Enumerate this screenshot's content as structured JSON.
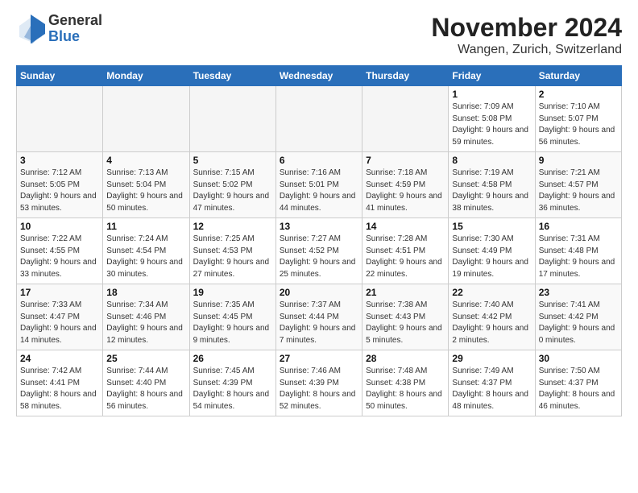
{
  "logo": {
    "general": "General",
    "blue": "Blue"
  },
  "title": "November 2024",
  "location": "Wangen, Zurich, Switzerland",
  "days_of_week": [
    "Sunday",
    "Monday",
    "Tuesday",
    "Wednesday",
    "Thursday",
    "Friday",
    "Saturday"
  ],
  "weeks": [
    [
      {
        "day": "",
        "info": ""
      },
      {
        "day": "",
        "info": ""
      },
      {
        "day": "",
        "info": ""
      },
      {
        "day": "",
        "info": ""
      },
      {
        "day": "",
        "info": ""
      },
      {
        "day": "1",
        "info": "Sunrise: 7:09 AM\nSunset: 5:08 PM\nDaylight: 9 hours and 59 minutes."
      },
      {
        "day": "2",
        "info": "Sunrise: 7:10 AM\nSunset: 5:07 PM\nDaylight: 9 hours and 56 minutes."
      }
    ],
    [
      {
        "day": "3",
        "info": "Sunrise: 7:12 AM\nSunset: 5:05 PM\nDaylight: 9 hours and 53 minutes."
      },
      {
        "day": "4",
        "info": "Sunrise: 7:13 AM\nSunset: 5:04 PM\nDaylight: 9 hours and 50 minutes."
      },
      {
        "day": "5",
        "info": "Sunrise: 7:15 AM\nSunset: 5:02 PM\nDaylight: 9 hours and 47 minutes."
      },
      {
        "day": "6",
        "info": "Sunrise: 7:16 AM\nSunset: 5:01 PM\nDaylight: 9 hours and 44 minutes."
      },
      {
        "day": "7",
        "info": "Sunrise: 7:18 AM\nSunset: 4:59 PM\nDaylight: 9 hours and 41 minutes."
      },
      {
        "day": "8",
        "info": "Sunrise: 7:19 AM\nSunset: 4:58 PM\nDaylight: 9 hours and 38 minutes."
      },
      {
        "day": "9",
        "info": "Sunrise: 7:21 AM\nSunset: 4:57 PM\nDaylight: 9 hours and 36 minutes."
      }
    ],
    [
      {
        "day": "10",
        "info": "Sunrise: 7:22 AM\nSunset: 4:55 PM\nDaylight: 9 hours and 33 minutes."
      },
      {
        "day": "11",
        "info": "Sunrise: 7:24 AM\nSunset: 4:54 PM\nDaylight: 9 hours and 30 minutes."
      },
      {
        "day": "12",
        "info": "Sunrise: 7:25 AM\nSunset: 4:53 PM\nDaylight: 9 hours and 27 minutes."
      },
      {
        "day": "13",
        "info": "Sunrise: 7:27 AM\nSunset: 4:52 PM\nDaylight: 9 hours and 25 minutes."
      },
      {
        "day": "14",
        "info": "Sunrise: 7:28 AM\nSunset: 4:51 PM\nDaylight: 9 hours and 22 minutes."
      },
      {
        "day": "15",
        "info": "Sunrise: 7:30 AM\nSunset: 4:49 PM\nDaylight: 9 hours and 19 minutes."
      },
      {
        "day": "16",
        "info": "Sunrise: 7:31 AM\nSunset: 4:48 PM\nDaylight: 9 hours and 17 minutes."
      }
    ],
    [
      {
        "day": "17",
        "info": "Sunrise: 7:33 AM\nSunset: 4:47 PM\nDaylight: 9 hours and 14 minutes."
      },
      {
        "day": "18",
        "info": "Sunrise: 7:34 AM\nSunset: 4:46 PM\nDaylight: 9 hours and 12 minutes."
      },
      {
        "day": "19",
        "info": "Sunrise: 7:35 AM\nSunset: 4:45 PM\nDaylight: 9 hours and 9 minutes."
      },
      {
        "day": "20",
        "info": "Sunrise: 7:37 AM\nSunset: 4:44 PM\nDaylight: 9 hours and 7 minutes."
      },
      {
        "day": "21",
        "info": "Sunrise: 7:38 AM\nSunset: 4:43 PM\nDaylight: 9 hours and 5 minutes."
      },
      {
        "day": "22",
        "info": "Sunrise: 7:40 AM\nSunset: 4:42 PM\nDaylight: 9 hours and 2 minutes."
      },
      {
        "day": "23",
        "info": "Sunrise: 7:41 AM\nSunset: 4:42 PM\nDaylight: 9 hours and 0 minutes."
      }
    ],
    [
      {
        "day": "24",
        "info": "Sunrise: 7:42 AM\nSunset: 4:41 PM\nDaylight: 8 hours and 58 minutes."
      },
      {
        "day": "25",
        "info": "Sunrise: 7:44 AM\nSunset: 4:40 PM\nDaylight: 8 hours and 56 minutes."
      },
      {
        "day": "26",
        "info": "Sunrise: 7:45 AM\nSunset: 4:39 PM\nDaylight: 8 hours and 54 minutes."
      },
      {
        "day": "27",
        "info": "Sunrise: 7:46 AM\nSunset: 4:39 PM\nDaylight: 8 hours and 52 minutes."
      },
      {
        "day": "28",
        "info": "Sunrise: 7:48 AM\nSunset: 4:38 PM\nDaylight: 8 hours and 50 minutes."
      },
      {
        "day": "29",
        "info": "Sunrise: 7:49 AM\nSunset: 4:37 PM\nDaylight: 8 hours and 48 minutes."
      },
      {
        "day": "30",
        "info": "Sunrise: 7:50 AM\nSunset: 4:37 PM\nDaylight: 8 hours and 46 minutes."
      }
    ]
  ]
}
